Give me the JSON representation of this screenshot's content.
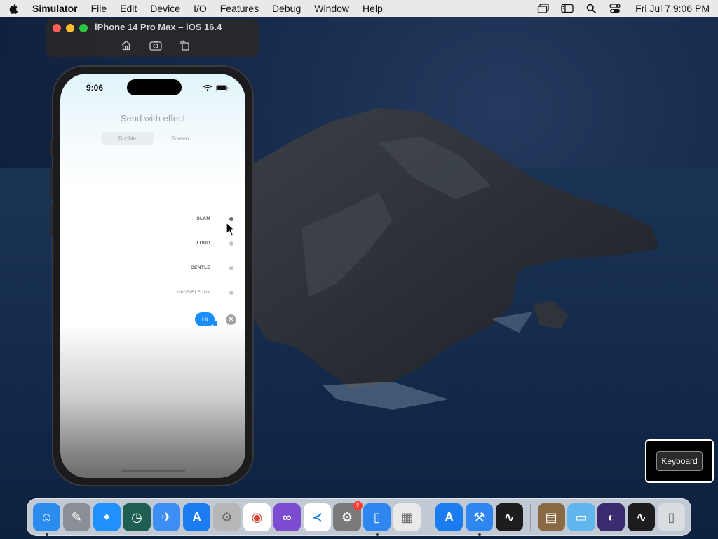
{
  "menubar": {
    "app_name": "Simulator",
    "items": [
      "File",
      "Edit",
      "Device",
      "I/O",
      "Features",
      "Debug",
      "Window",
      "Help"
    ],
    "clock": "Fri Jul 7  9:06 PM"
  },
  "simulator": {
    "title": "iPhone 14 Pro Max – iOS 16.4",
    "tools": [
      "home-icon",
      "screenshot-icon",
      "rotate-icon"
    ]
  },
  "phone": {
    "status_time": "9:06",
    "screen_title": "Send with effect",
    "segments": [
      {
        "label": "Bubble",
        "selected": true
      },
      {
        "label": "Screen",
        "selected": false
      }
    ],
    "effects": [
      {
        "label": "SLAM",
        "selected": true
      },
      {
        "label": "LOUD",
        "selected": false
      },
      {
        "label": "GENTLE",
        "selected": false
      },
      {
        "label": "INVISIBLE INK",
        "selected": false
      }
    ],
    "message": "Hi"
  },
  "keyboard_hint": {
    "label": "Keyboard"
  },
  "dock": {
    "apps": [
      {
        "name": "Finder",
        "icon": "finder-icon",
        "color": "#2b8cf0",
        "running": true
      },
      {
        "name": "Script Editor",
        "icon": "script-editor-icon",
        "color": "#8a8f96",
        "running": false
      },
      {
        "name": "Safari",
        "icon": "safari-icon",
        "color": "#1e90ff",
        "running": false
      },
      {
        "name": "Time Machine",
        "icon": "time-machine-icon",
        "color": "#1f5f52",
        "running": false
      },
      {
        "name": "TestFlight",
        "icon": "testflight-icon",
        "color": "#3d8ff5",
        "running": false
      },
      {
        "name": "App Store",
        "icon": "app-store-icon",
        "color": "#1b7cf2",
        "running": false
      },
      {
        "name": "Automator",
        "icon": "automator-icon",
        "color": "#b7b7b7",
        "running": false
      },
      {
        "name": "Google Chrome",
        "icon": "chrome-icon",
        "color": "#ffffff",
        "running": false
      },
      {
        "name": "Visual Studio",
        "icon": "visual-studio-icon",
        "color": "#7b4bd0",
        "running": false
      },
      {
        "name": "Visual Studio Code",
        "icon": "vscode-icon",
        "color": "#ffffff",
        "running": false
      },
      {
        "name": "System Settings",
        "icon": "system-settings-icon",
        "color": "#7a7a7a",
        "running": false,
        "badge": "2"
      },
      {
        "name": "Simulator",
        "icon": "simulator-icon",
        "color": "#2f86f0",
        "running": true
      },
      {
        "name": "Launchpad",
        "icon": "launchpad-icon",
        "color": "#eaeaea",
        "running": false
      }
    ],
    "apps2": [
      {
        "name": "App Store",
        "icon": "app-store-icon",
        "color": "#1b7cf2",
        "running": false
      },
      {
        "name": "Xcode",
        "icon": "xcode-icon",
        "color": "#2f86f0",
        "running": true
      },
      {
        "name": "Activity Monitor",
        "icon": "activity-monitor-icon",
        "color": "#1d1d1f",
        "running": false
      }
    ],
    "apps3": [
      {
        "name": "Archive Utility",
        "icon": "archive-icon",
        "color": "#8a6a45",
        "running": false
      },
      {
        "name": "Downloads",
        "icon": "folder-icon",
        "color": "#62b6ee",
        "running": false
      },
      {
        "name": "Firefox",
        "icon": "firefox-icon",
        "color": "#3a2b6e",
        "running": false
      },
      {
        "name": "Activity Monitor",
        "icon": "activity-monitor-icon",
        "color": "#1d1d1f",
        "running": false
      },
      {
        "name": "Trash",
        "icon": "trash-icon",
        "color": "#d9dde2",
        "running": false
      }
    ]
  }
}
